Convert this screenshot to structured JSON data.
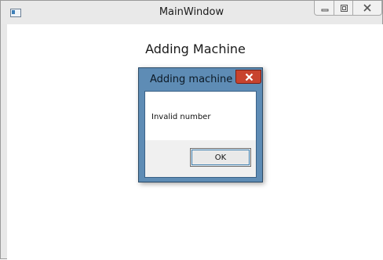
{
  "window": {
    "title": "MainWindow",
    "heading": "Adding Machine"
  },
  "dialog": {
    "title": "Adding machine",
    "message": "Invalid number",
    "ok_label": "OK"
  },
  "icons": {
    "app": "app-window-icon",
    "minimize": "minimize-icon",
    "maximize": "maximize-icon",
    "close": "close-icon",
    "dialog_close": "close-icon"
  },
  "colors": {
    "dialog_frame": "#5e8cb5",
    "dialog_close": "#c8432e",
    "ok_focus": "#3c7fb1"
  }
}
